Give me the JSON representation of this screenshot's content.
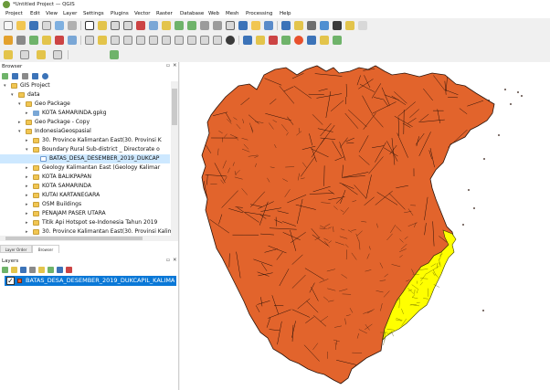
{
  "window": {
    "title": "*Untitled Project — QGIS"
  },
  "menubar": {
    "items": [
      "Project",
      "Edit",
      "View",
      "Layer",
      "Settings",
      "Plugins",
      "Vector",
      "Raster",
      "Database",
      "Web",
      "Mesh",
      "Processing",
      "Help"
    ]
  },
  "browser_panel": {
    "title": "Browser",
    "tree": [
      {
        "label": "GIS Project",
        "depth": 1,
        "expander": "▾",
        "icon": "folder",
        "selected": false
      },
      {
        "label": "data",
        "depth": 2,
        "expander": "▾",
        "icon": "folder",
        "selected": false
      },
      {
        "label": "Geo Package",
        "depth": 3,
        "expander": "▾",
        "icon": "folder",
        "selected": false
      },
      {
        "label": "KOTA SAMARINDA.gpkg",
        "depth": 4,
        "expander": "▸",
        "icon": "gpkg",
        "selected": false
      },
      {
        "label": "Geo Package - Copy",
        "depth": 3,
        "expander": "▸",
        "icon": "folder",
        "selected": false
      },
      {
        "label": "IndonesiaGeospasial",
        "depth": 3,
        "expander": "▾",
        "icon": "folder",
        "selected": false
      },
      {
        "label": "30. Province Kalimantan East(30. Provinsi K",
        "depth": 4,
        "expander": "▸",
        "icon": "folder",
        "selected": false
      },
      {
        "label": "Boundary Rural Sub-district _ Directorate o",
        "depth": 4,
        "expander": "▾",
        "icon": "folder",
        "selected": false
      },
      {
        "label": "BATAS_DESA_DESEMBER_2019_DUKCAP",
        "depth": 5,
        "expander": "",
        "icon": "vector",
        "selected": true
      },
      {
        "label": "Geology Kalimantan East (Geology Kalimar",
        "depth": 4,
        "expander": "▸",
        "icon": "folder",
        "selected": false
      },
      {
        "label": "KOTA BALIKPAPAN",
        "depth": 4,
        "expander": "▸",
        "icon": "folder",
        "selected": false
      },
      {
        "label": "KOTA SAMARINDA",
        "depth": 4,
        "expander": "▸",
        "icon": "folder",
        "selected": false
      },
      {
        "label": "KUTAI KARTANEGARA",
        "depth": 4,
        "expander": "▸",
        "icon": "folder",
        "selected": false
      },
      {
        "label": "OSM Buildings",
        "depth": 4,
        "expander": "▸",
        "icon": "folder",
        "selected": false
      },
      {
        "label": "PENAJAM PASER UTARA",
        "depth": 4,
        "expander": "▸",
        "icon": "folder",
        "selected": false
      },
      {
        "label": "Titik Api Hotspot se-Indonesia Tahun 2019",
        "depth": 4,
        "expander": "▸",
        "icon": "folder",
        "selected": false
      },
      {
        "label": "30. Province Kalimantan East(30. Provinsi Kalimantan",
        "depth": 4,
        "expander": "▸",
        "icon": "folder",
        "selected": false
      }
    ]
  },
  "bottom_tabs": [
    {
      "label": "Layer Order"
    },
    {
      "label": "Browser"
    }
  ],
  "layers_panel": {
    "title": "Layers",
    "layers": [
      {
        "label": "BATAS_DESA_DESEMBER_2019_DUKCAPIL_KALIMA",
        "checked": true,
        "checkmark": "✓",
        "symbol_color": "#e8602c"
      }
    ]
  },
  "colors": {
    "map_fill_main": "#e2642c",
    "map_fill_selected": "#ffff00",
    "map_outline": "#2a1208",
    "selection_highlight": "#0a78d7"
  }
}
